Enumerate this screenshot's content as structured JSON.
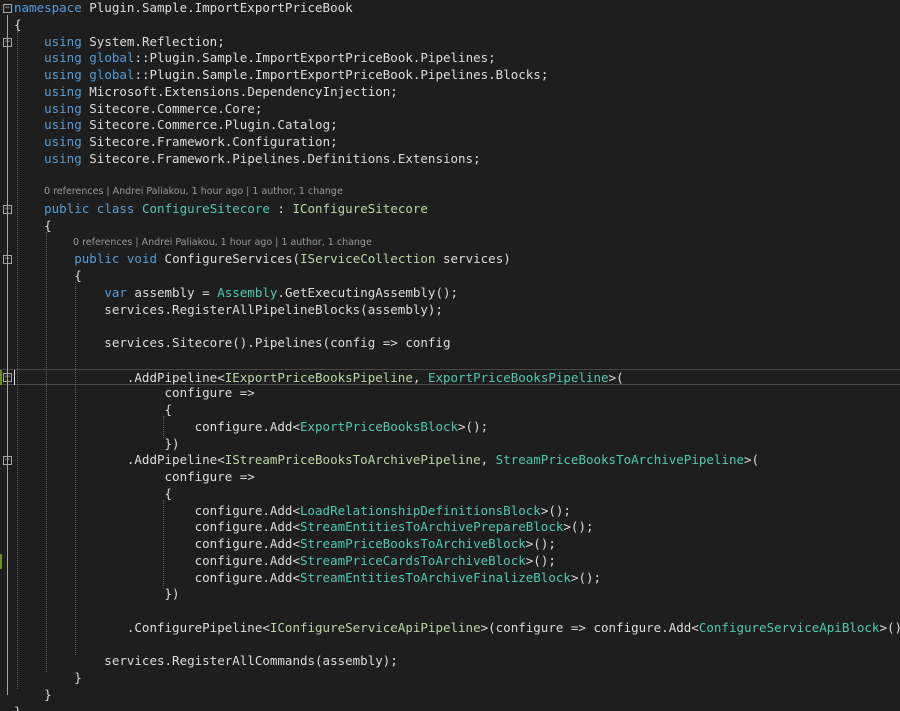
{
  "editor": {
    "theme_colors": {
      "background": "#1e1e1e",
      "keyword": "#569cd6",
      "type": "#4ec9b0",
      "interface": "#b8d7a3",
      "text": "#dcdcdc",
      "codelens": "#999999"
    },
    "codelens": {
      "class_info": "0 references | Andrei Paliakou, 1 hour ago | 1 author, 1 change",
      "method_info": "0 references | Andrei Paliakou, 1 hour ago | 1 author, 1 change"
    },
    "lines": [
      {
        "type": "code",
        "tokens": [
          {
            "c": "kw",
            "t": "namespace"
          },
          {
            "c": "pl",
            "t": " Plugin.Sample.ImportExportPriceBook"
          }
        ]
      },
      {
        "type": "code",
        "tokens": [
          {
            "c": "pl",
            "t": "{"
          }
        ]
      },
      {
        "type": "code",
        "tokens": [
          {
            "c": "pl",
            "t": "    "
          },
          {
            "c": "kw",
            "t": "using"
          },
          {
            "c": "pl",
            "t": " System.Reflection;"
          }
        ]
      },
      {
        "type": "code",
        "tokens": [
          {
            "c": "pl",
            "t": "    "
          },
          {
            "c": "kw",
            "t": "using"
          },
          {
            "c": "pl",
            "t": " "
          },
          {
            "c": "kw",
            "t": "global"
          },
          {
            "c": "pl",
            "t": "::Plugin.Sample.ImportExportPriceBook.Pipelines;"
          }
        ]
      },
      {
        "type": "code",
        "tokens": [
          {
            "c": "pl",
            "t": "    "
          },
          {
            "c": "kw",
            "t": "using"
          },
          {
            "c": "pl",
            "t": " "
          },
          {
            "c": "kw",
            "t": "global"
          },
          {
            "c": "pl",
            "t": "::Plugin.Sample.ImportExportPriceBook.Pipelines.Blocks;"
          }
        ]
      },
      {
        "type": "code",
        "tokens": [
          {
            "c": "pl",
            "t": "    "
          },
          {
            "c": "kw",
            "t": "using"
          },
          {
            "c": "pl",
            "t": " Microsoft.Extensions.DependencyInjection;"
          }
        ]
      },
      {
        "type": "code",
        "tokens": [
          {
            "c": "pl",
            "t": "    "
          },
          {
            "c": "kw",
            "t": "using"
          },
          {
            "c": "pl",
            "t": " Sitecore.Commerce.Core;"
          }
        ]
      },
      {
        "type": "code",
        "tokens": [
          {
            "c": "pl",
            "t": "    "
          },
          {
            "c": "kw",
            "t": "using"
          },
          {
            "c": "pl",
            "t": " Sitecore.Commerce.Plugin.Catalog;"
          }
        ]
      },
      {
        "type": "code",
        "tokens": [
          {
            "c": "pl",
            "t": "    "
          },
          {
            "c": "kw",
            "t": "using"
          },
          {
            "c": "pl",
            "t": " Sitecore.Framework.Configuration;"
          }
        ]
      },
      {
        "type": "code",
        "tokens": [
          {
            "c": "pl",
            "t": "    "
          },
          {
            "c": "kw",
            "t": "using"
          },
          {
            "c": "pl",
            "t": " Sitecore.Framework.Pipelines.Definitions.Extensions;"
          }
        ]
      },
      {
        "type": "code",
        "tokens": []
      },
      {
        "type": "lens",
        "bind": "class_info"
      },
      {
        "type": "code",
        "tokens": [
          {
            "c": "pl",
            "t": "    "
          },
          {
            "c": "kw",
            "t": "public"
          },
          {
            "c": "pl",
            "t": " "
          },
          {
            "c": "kw",
            "t": "class"
          },
          {
            "c": "pl",
            "t": " "
          },
          {
            "c": "ty",
            "t": "ConfigureSitecore"
          },
          {
            "c": "pl",
            "t": " : "
          },
          {
            "c": "in",
            "t": "IConfigureSitecore"
          }
        ]
      },
      {
        "type": "code",
        "tokens": [
          {
            "c": "pl",
            "t": "    {"
          }
        ]
      },
      {
        "type": "lens",
        "bind": "method_info",
        "indent": 1
      },
      {
        "type": "code",
        "tokens": [
          {
            "c": "pl",
            "t": "        "
          },
          {
            "c": "kw",
            "t": "public"
          },
          {
            "c": "pl",
            "t": " "
          },
          {
            "c": "kw",
            "t": "void"
          },
          {
            "c": "pl",
            "t": " ConfigureServices("
          },
          {
            "c": "in",
            "t": "IServiceCollection"
          },
          {
            "c": "pl",
            "t": " services)"
          }
        ]
      },
      {
        "type": "code",
        "tokens": [
          {
            "c": "pl",
            "t": "        {"
          }
        ]
      },
      {
        "type": "code",
        "tokens": [
          {
            "c": "pl",
            "t": "            "
          },
          {
            "c": "kw",
            "t": "var"
          },
          {
            "c": "pl",
            "t": " assembly = "
          },
          {
            "c": "ty",
            "t": "Assembly"
          },
          {
            "c": "pl",
            "t": ".GetExecutingAssembly();"
          }
        ]
      },
      {
        "type": "code",
        "tokens": [
          {
            "c": "pl",
            "t": "            services.RegisterAllPipelineBlocks(assembly);"
          }
        ]
      },
      {
        "type": "code",
        "tokens": []
      },
      {
        "type": "code",
        "tokens": [
          {
            "c": "pl",
            "t": "            services.Sitecore().Pipelines(config => config"
          }
        ]
      },
      {
        "type": "code",
        "tokens": []
      },
      {
        "type": "code",
        "current": true,
        "tokens": [
          {
            "c": "pl",
            "t": "               .AddPipeline<"
          },
          {
            "c": "in",
            "t": "IExportPriceBooksPipeline"
          },
          {
            "c": "pl",
            "t": ", "
          },
          {
            "c": "ty",
            "t": "ExportPriceBooksPipeline"
          },
          {
            "c": "pl",
            "t": ">("
          }
        ]
      },
      {
        "type": "code",
        "tokens": [
          {
            "c": "pl",
            "t": "                    configure =>"
          }
        ]
      },
      {
        "type": "code",
        "tokens": [
          {
            "c": "pl",
            "t": "                    {"
          }
        ]
      },
      {
        "type": "code",
        "tokens": [
          {
            "c": "pl",
            "t": "                        configure.Add<"
          },
          {
            "c": "ty",
            "t": "ExportPriceBooksBlock"
          },
          {
            "c": "pl",
            "t": ">();"
          }
        ]
      },
      {
        "type": "code",
        "tokens": [
          {
            "c": "pl",
            "t": "                    })"
          }
        ]
      },
      {
        "type": "code",
        "tokens": [
          {
            "c": "pl",
            "t": "               .AddPipeline<"
          },
          {
            "c": "in",
            "t": "IStreamPriceBooksToArchivePipeline"
          },
          {
            "c": "pl",
            "t": ", "
          },
          {
            "c": "ty",
            "t": "StreamPriceBooksToArchivePipeline"
          },
          {
            "c": "pl",
            "t": ">("
          }
        ]
      },
      {
        "type": "code",
        "tokens": [
          {
            "c": "pl",
            "t": "                    configure =>"
          }
        ]
      },
      {
        "type": "code",
        "tokens": [
          {
            "c": "pl",
            "t": "                    {"
          }
        ]
      },
      {
        "type": "code",
        "tokens": [
          {
            "c": "pl",
            "t": "                        configure.Add<"
          },
          {
            "c": "ty",
            "t": "LoadRelationshipDefinitionsBlock"
          },
          {
            "c": "pl",
            "t": ">();"
          }
        ]
      },
      {
        "type": "code",
        "tokens": [
          {
            "c": "pl",
            "t": "                        configure.Add<"
          },
          {
            "c": "ty",
            "t": "StreamEntitiesToArchivePrepareBlock"
          },
          {
            "c": "pl",
            "t": ">();"
          }
        ]
      },
      {
        "type": "code",
        "tokens": [
          {
            "c": "pl",
            "t": "                        configure.Add<"
          },
          {
            "c": "ty",
            "t": "StreamPriceBooksToArchiveBlock"
          },
          {
            "c": "pl",
            "t": ">();"
          }
        ]
      },
      {
        "type": "code",
        "tokens": [
          {
            "c": "pl",
            "t": "                        configure.Add<"
          },
          {
            "c": "ty",
            "t": "StreamPriceCardsToArchiveBlock"
          },
          {
            "c": "pl",
            "t": ">();"
          }
        ]
      },
      {
        "type": "code",
        "tokens": [
          {
            "c": "pl",
            "t": "                        configure.Add<"
          },
          {
            "c": "ty",
            "t": "StreamEntitiesToArchiveFinalizeBlock"
          },
          {
            "c": "pl",
            "t": ">();"
          }
        ]
      },
      {
        "type": "code",
        "tokens": [
          {
            "c": "pl",
            "t": "                    })"
          }
        ]
      },
      {
        "type": "code",
        "tokens": []
      },
      {
        "type": "code",
        "tokens": [
          {
            "c": "pl",
            "t": "               .ConfigurePipeline<"
          },
          {
            "c": "in",
            "t": "IConfigureServiceApiPipeline"
          },
          {
            "c": "pl",
            "t": ">(configure => configure.Add<"
          },
          {
            "c": "ty",
            "t": "ConfigureServiceApiBlock"
          },
          {
            "c": "pl",
            "t": ">()));"
          }
        ]
      },
      {
        "type": "code",
        "tokens": []
      },
      {
        "type": "code",
        "tokens": [
          {
            "c": "pl",
            "t": "            services.RegisterAllCommands(assembly);"
          }
        ]
      },
      {
        "type": "code",
        "tokens": [
          {
            "c": "pl",
            "t": "        }"
          }
        ]
      },
      {
        "type": "code",
        "tokens": [
          {
            "c": "pl",
            "t": "    }"
          }
        ]
      },
      {
        "type": "code",
        "tokens": [
          {
            "c": "pl",
            "t": "}"
          }
        ]
      }
    ]
  }
}
